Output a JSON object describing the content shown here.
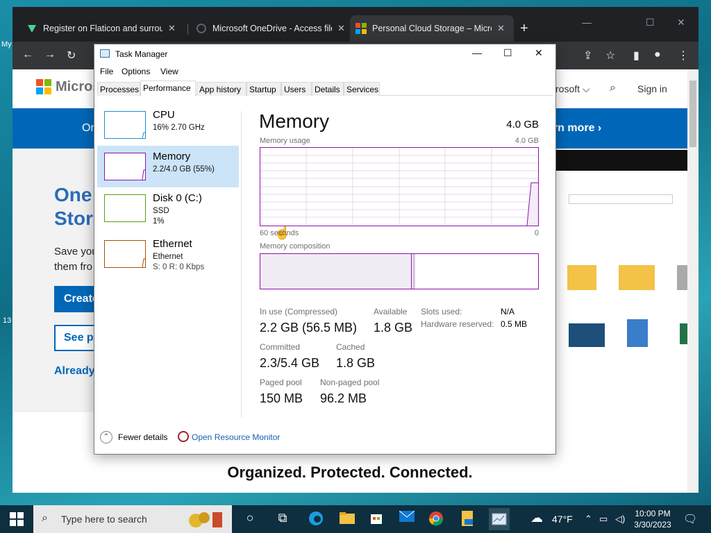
{
  "browser": {
    "tabs": [
      {
        "title": "Register on Flaticon and surrou",
        "active": false
      },
      {
        "title": "Microsoft OneDrive - Access file",
        "active": false
      },
      {
        "title": "Personal Cloud Storage – Micros",
        "active": true
      }
    ],
    "new_tab": "+",
    "window_controls": [
      "—",
      "☐",
      "✕"
    ]
  },
  "page": {
    "brand": "Microso",
    "right_link": "rosoft ⌵",
    "sign_in": "Sign in",
    "banner_left": "Or",
    "banner_right": "arn more ›",
    "hero_title_1": "One",
    "hero_title_2": "Stora",
    "hero_text_1": "Save you",
    "hero_text_2": "them fro",
    "create_btn": "Create",
    "see_btn": "See pl",
    "already": "Already",
    "tagline": "Organized. Protected. Connected."
  },
  "task_manager": {
    "title": "Task Manager",
    "menu": [
      "File",
      "Options",
      "View"
    ],
    "tabs": [
      "Processes",
      "Performance",
      "App history",
      "Startup",
      "Users",
      "Details",
      "Services"
    ],
    "selected_tab": "Performance",
    "sidebar": [
      {
        "name": "CPU",
        "sub1": "16% 2.70 GHz",
        "sub2": "",
        "color": "#1b8fd1"
      },
      {
        "name": "Memory",
        "sub1": "2.2/4.0 GB (55%)",
        "sub2": "",
        "color": "#8b12ae"
      },
      {
        "name": "Disk 0 (C:)",
        "sub1": "SSD",
        "sub2": "1%",
        "color": "#4da60c"
      },
      {
        "name": "Ethernet",
        "sub1": "Ethernet",
        "sub2": "S: 0  R: 0 Kbps",
        "color": "#a74f01"
      }
    ],
    "main_title": "Memory",
    "total": "4.0 GB",
    "usage_label": "Memory usage",
    "usage_max": "4.0 GB",
    "time_left": "60 seconds",
    "time_right": "0",
    "composition_label": "Memory composition",
    "memory_usage_percent": 55,
    "stats": {
      "in_use_label": "In use (Compressed)",
      "in_use_value": "2.2 GB (56.5 MB)",
      "available_label": "Available",
      "available_value": "1.8 GB",
      "committed_label": "Committed",
      "committed_value": "2.3/5.4 GB",
      "cached_label": "Cached",
      "cached_value": "1.8 GB",
      "paged_label": "Paged pool",
      "paged_value": "150 MB",
      "nonpaged_label": "Non-paged pool",
      "nonpaged_value": "96.2 MB",
      "slots_label": "Slots used:",
      "slots_value": "N/A",
      "hw_label": "Hardware reserved:",
      "hw_value": "0.5 MB"
    },
    "fewer_details": "Fewer details",
    "open_resource_monitor": "Open Resource Monitor"
  },
  "taskbar": {
    "search_placeholder": "Type here to search",
    "weather": "47°F",
    "time": "10:00 PM",
    "date": "3/30/2023"
  },
  "colors": {
    "memory_accent": "#8b12ae",
    "link_blue": "#0067b8",
    "selection": "#cce4f7"
  }
}
